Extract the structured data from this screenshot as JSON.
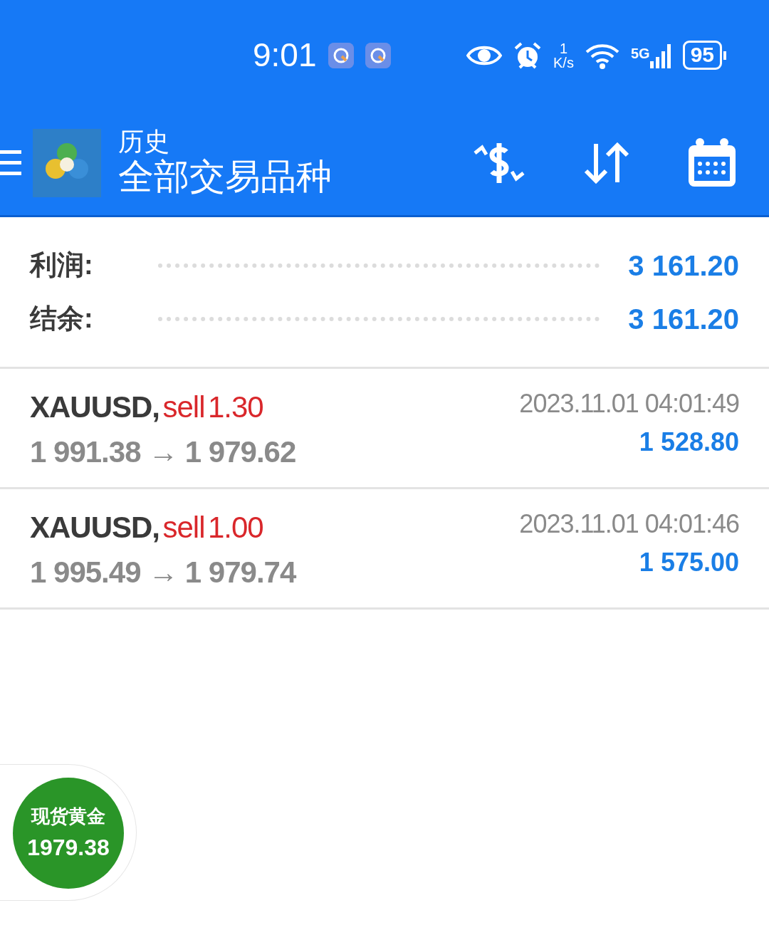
{
  "status_bar": {
    "time": "9:01",
    "speed_value": "1",
    "speed_unit": "K/s",
    "network": "5G",
    "battery": "95"
  },
  "header": {
    "title": "历史",
    "subtitle": "全部交易品种"
  },
  "summary": [
    {
      "label": "利润:",
      "value": "3 161.20"
    },
    {
      "label": "结余:",
      "value": "3 161.20"
    }
  ],
  "trades": [
    {
      "symbol": "XAUUSD,",
      "side": "sell",
      "volume": "1.30",
      "prices": "1 991.38 → 1 979.62",
      "time": "2023.11.01 04:01:49",
      "profit": "1 528.80"
    },
    {
      "symbol": "XAUUSD,",
      "side": "sell",
      "volume": "1.00",
      "prices": "1 995.49 → 1 979.74",
      "time": "2023.11.01 04:01:46",
      "profit": "1 575.00"
    }
  ],
  "floating_widget": {
    "title": "现货黄金",
    "price": "1979.38"
  }
}
